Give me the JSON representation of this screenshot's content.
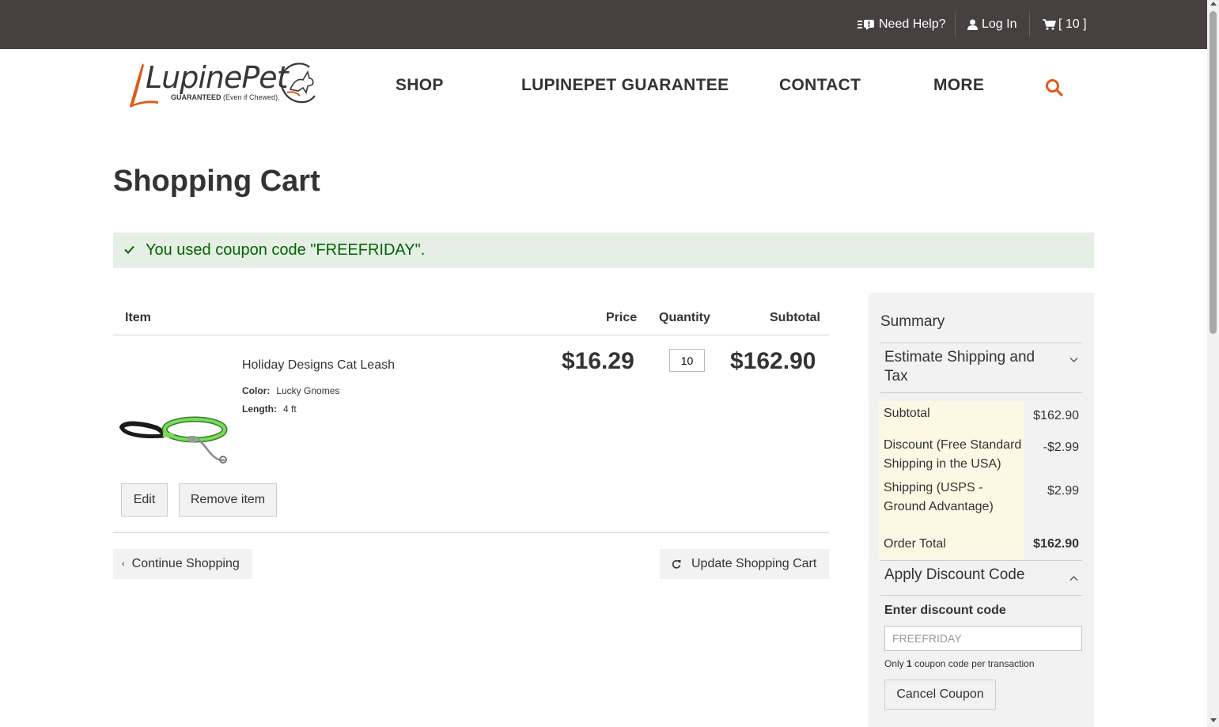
{
  "topbar": {
    "help": "Need Help?",
    "login": "Log In",
    "cart_count": "[ 10 ]"
  },
  "logo": {
    "name": "LupinePet",
    "tagline_bold": "GUARANTEED",
    "tagline_rest": "(Even if Chewed)."
  },
  "nav": {
    "shop": "SHOP",
    "guarantee": "LUPINEPET GUARANTEE",
    "contact": "CONTACT",
    "more": "MORE"
  },
  "page_title": "Shopping Cart",
  "coupon_message": "You used coupon code \"FREEFRIDAY\".",
  "cart": {
    "headers": {
      "item": "Item",
      "price": "Price",
      "quantity": "Quantity",
      "subtotal": "Subtotal"
    },
    "items": [
      {
        "name": "Holiday Designs Cat Leash",
        "attributes": [
          {
            "label": "Color:",
            "value": "Lucky Gnomes"
          },
          {
            "label": "Length:",
            "value": "4 ft"
          }
        ],
        "price": "$16.29",
        "quantity": "10",
        "subtotal": "$162.90",
        "edit_label": "Edit",
        "remove_label": "Remove item"
      }
    ],
    "continue_label": "Continue Shopping",
    "update_label": "Update Shopping Cart"
  },
  "summary": {
    "title": "Summary",
    "estimate_label": "Estimate Shipping and Tax",
    "rows": [
      {
        "label": "Subtotal",
        "value": "$162.90"
      },
      {
        "label": "Discount (Free Standard Shipping in the USA)",
        "value": "-$2.99"
      },
      {
        "label": "Shipping (USPS - Ground Advantage)",
        "value": "$2.99"
      }
    ],
    "order_total_label": "Order Total",
    "order_total_value": "$162.90",
    "discount_section_label": "Apply Discount Code",
    "discount_field_label": "Enter discount code",
    "discount_value": "FREEFRIDAY",
    "note_pre": "Only",
    "note_num": "1",
    "note_post": "coupon code per transaction",
    "cancel_label": "Cancel Coupon"
  },
  "colors": {
    "topbar_bg": "#464041",
    "accent_orange": "#e05a1c",
    "success_bg": "#e5efe5",
    "success_text": "#006400",
    "totals_bg": "#fdf8e4"
  }
}
